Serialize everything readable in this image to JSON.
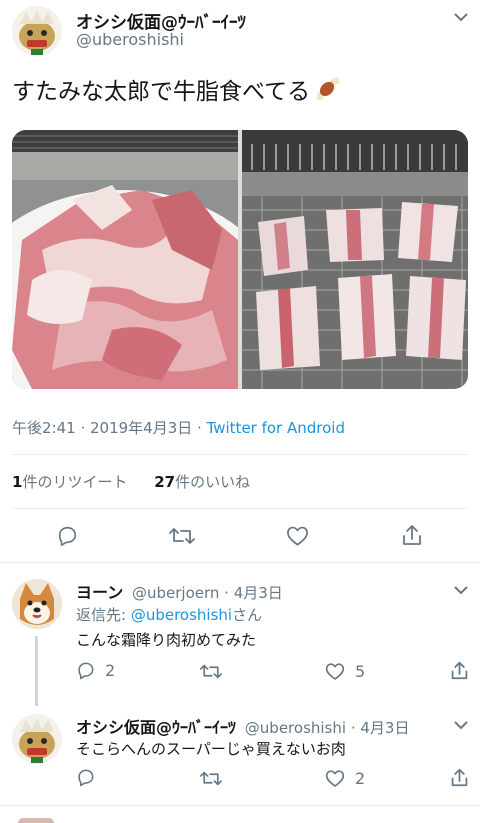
{
  "tweet": {
    "display_name": "オシシ仮面@ｳｰﾊﾞｰｲｰﾂ",
    "handle": "@uberoshishi",
    "text": "すたみな太郎で牛脂食べてる",
    "emoji_icon": "meat-on-bone-icon",
    "timestamp": "午後2:41 · 2019年4月3日 · ",
    "source": "Twitter for Android",
    "retweet_count": "1",
    "retweet_label": "件のリツイート",
    "like_count": "27",
    "like_label": "件のいいね"
  },
  "replies": [
    {
      "display_name": "ヨーン",
      "handle": "@uberjoern · 4月3日",
      "reply_prefix": "返信先: ",
      "reply_to": "@uberoshishi",
      "reply_suffix": "さん",
      "text": "こんな霜降り肉初めてみた",
      "reply_count": "2",
      "retweet_count": "",
      "like_count": "5"
    },
    {
      "display_name": "オシシ仮面@ｳｰﾊﾞｰｲｰﾂ",
      "handle": "@uberoshishi · 4月3日",
      "text": "そこらへんのスーパーじゃ買えないお肉",
      "reply_count": "",
      "retweet_count": "",
      "like_count": "2"
    }
  ],
  "colors": {
    "link": "#1b95e0",
    "muted": "#657786",
    "divider": "#e6ecf0",
    "text": "#14171a"
  }
}
